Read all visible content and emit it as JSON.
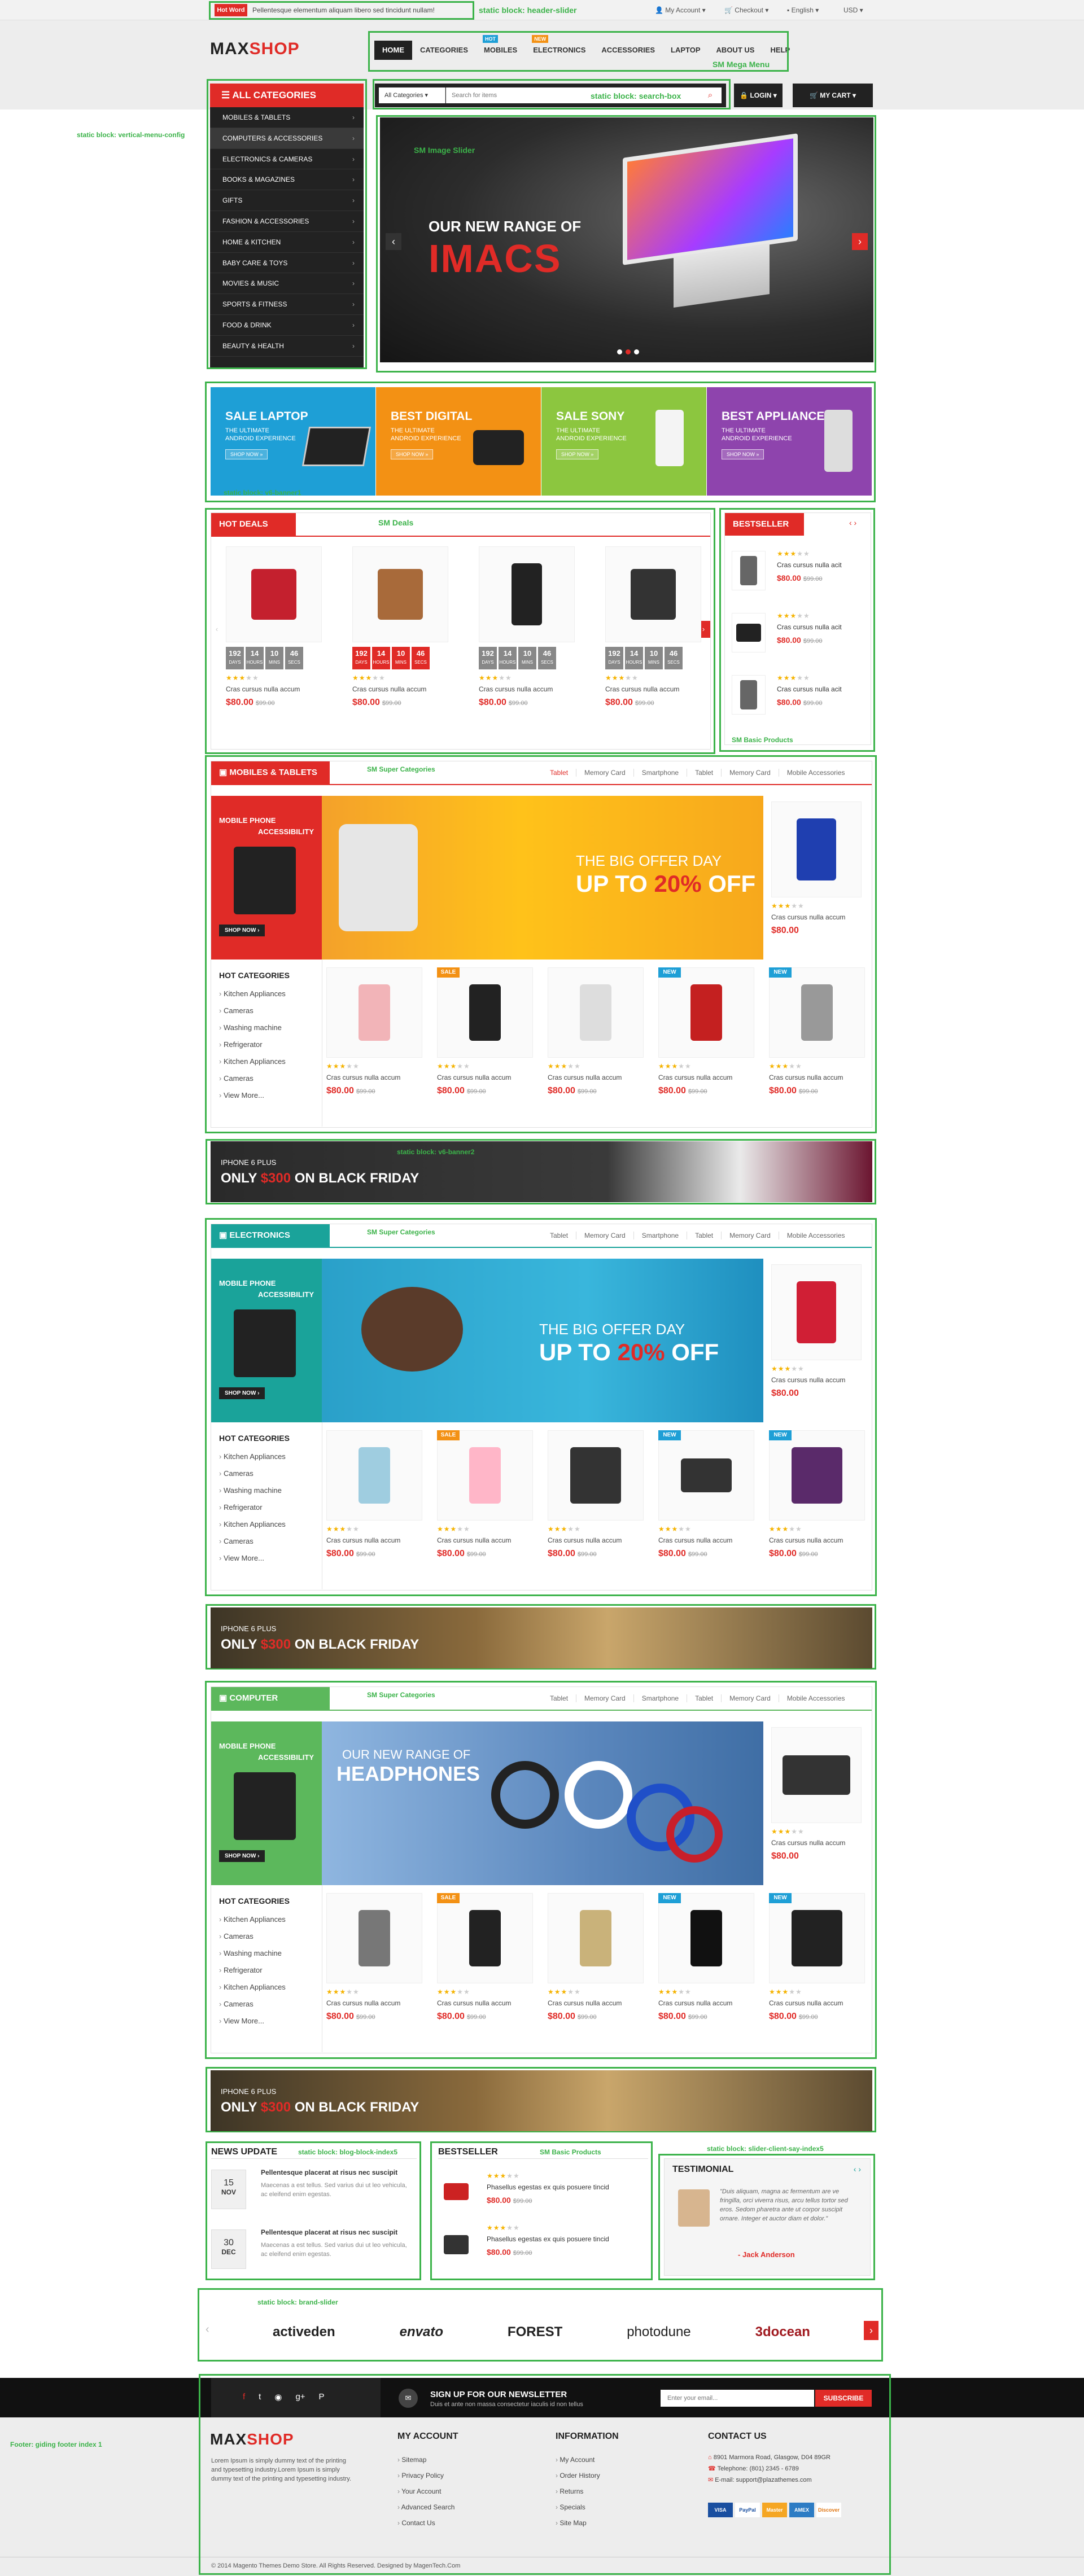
{
  "topbar": {
    "hot_word": "Hot Word",
    "ticker": "Pellentesque elementum aliquam libero sed tincidunt nullam!",
    "account": "My Account",
    "checkout": "Checkout",
    "language": "English",
    "currency": "USD"
  },
  "header": {
    "logo_main": "MAX",
    "logo_accent": "SHOP",
    "search_category": "All Categories",
    "search_placeholder": "Search for items",
    "login": "LOGIN",
    "cart": "MY CART"
  },
  "nav": {
    "items": [
      {
        "label": "HOME",
        "badge": ""
      },
      {
        "label": "CATEGORIES",
        "badge": ""
      },
      {
        "label": "MOBILES",
        "badge": "HOT"
      },
      {
        "label": "ELECTRONICS",
        "badge": "NEW"
      },
      {
        "label": "ACCESSORIES",
        "badge": ""
      },
      {
        "label": "LAPTOP",
        "badge": ""
      },
      {
        "label": "ABOUT US",
        "badge": ""
      },
      {
        "label": "HELP",
        "badge": ""
      }
    ]
  },
  "categories": {
    "title": "ALL CATEGORIES",
    "items": [
      "MOBILES & TABLETS",
      "COMPUTERS & ACCESSORIES",
      "ELECTRONICS & CAMERAS",
      "BOOKS & MAGAZINES",
      "GIFTS",
      "FASHION & ACCESSORIES",
      "HOME & KITCHEN",
      "BABY CARE & TOYS",
      "MOVIES & MUSIC",
      "SPORTS & FITNESS",
      "FOOD & DRINK",
      "BEAUTY & HEALTH"
    ]
  },
  "slider": {
    "line1": "OUR NEW RANGE OF",
    "line2": "IMACS"
  },
  "banners": [
    {
      "title": "SALE LAPTOP",
      "text1": "THE ULTIMATE",
      "text2": "ANDROID EXPERIENCE",
      "cta": "SHOP NOW »",
      "color": "#1e9fd6"
    },
    {
      "title": "BEST DIGITAL",
      "text1": "THE ULTIMATE",
      "text2": "ANDROID EXPERIENCE",
      "cta": "SHOP NOW »",
      "color": "#f39114"
    },
    {
      "title": "SALE SONY",
      "text1": "THE ULTIMATE",
      "text2": "ANDROID EXPERIENCE",
      "cta": "SHOP NOW »",
      "color": "#8cc63f"
    },
    {
      "title": "BEST APPLIANCES",
      "text1": "THE ULTIMATE",
      "text2": "ANDROID EXPERIENCE",
      "cta": "SHOP NOW »",
      "color": "#8e44ad"
    }
  ],
  "annotations": {
    "header_slider": "static block: header-slider",
    "mega_menu": "SM Mega Menu",
    "search_box": "static block: search-box",
    "vertical_menu": "static block: vertical-menu-config",
    "image_slider": "SM Image Slider",
    "v6_banner1": "static block: v6-banner1",
    "sm_deals": "SM Deals",
    "basic_products": "SM Basic Products",
    "super_categories": "SM Super Categories",
    "v6_banner2": "static block: v6-banner2",
    "blog_block": "static block: blog-block-index5",
    "slider_client": "static block: slider-client-say-index5",
    "brand_slider": "static block: brand-slider",
    "footer": "Footer: giding footer index 1"
  },
  "product": {
    "name": "Cras cursus nulla accum",
    "price": "$80.00",
    "old_price": "$99.00"
  },
  "hot_deals": {
    "title": "HOT DEALS",
    "countdown": [
      {
        "v": "192",
        "u": "DAYS"
      },
      {
        "v": "14",
        "u": "HOURS"
      },
      {
        "v": "10",
        "u": "MINS"
      },
      {
        "v": "46",
        "u": "SECS"
      }
    ]
  },
  "bestseller": {
    "title": "BESTSELLER",
    "item_name": "Cras cursus nulla acit"
  },
  "sections": [
    {
      "title": "MOBILES & TABLETS",
      "color": "#e02b27",
      "promo_small": "MOBILE PHONE",
      "promo_small2": "ACCESSIBILITY",
      "banner_l1": "THE BIG OFFER DAY",
      "banner_l2": "UP TO ",
      "banner_pct": "20%",
      "banner_l3": " OFF"
    },
    {
      "title": "ELECTRONICS",
      "color": "#1aa39a",
      "promo_small": "MOBILE PHONE",
      "promo_small2": "ACCESSIBILITY",
      "banner_l1": "THE BIG OFFER DAY",
      "banner_l2": "UP TO ",
      "banner_pct": "20%",
      "banner_l3": " OFF"
    },
    {
      "title": "COMPUTER",
      "color": "#5cb85c",
      "promo_small": "MOBILE PHONE",
      "promo_small2": "ACCESSIBILITY",
      "banner_l1": "OUR NEW RANGE OF",
      "banner_l2": "HEADPHONES",
      "banner_pct": "",
      "banner_l3": ""
    }
  ],
  "sub_tabs": [
    "Tablet",
    "Memory Card",
    "Smartphone",
    "Tablet",
    "Memory Card",
    "Mobile Accessories"
  ],
  "hot_categories": {
    "title": "HOT CATEGORIES",
    "items": [
      "Kitchen Appliances",
      "Cameras",
      "Washing machine",
      "Refrigerator",
      "Kitchen Appliances",
      "Cameras",
      "View More..."
    ]
  },
  "shop_now": "SHOP NOW ›",
  "promo": {
    "line1": "IPHONE 6 PLUS",
    "line2a": "ONLY ",
    "line2b": "$300",
    "line2c": " ON BLACK FRIDAY"
  },
  "news": {
    "title": "NEWS UPDATE",
    "posts": [
      {
        "day": "15",
        "month": "NOV",
        "title": "Pellentesque placerat at risus nec suscipit",
        "text": "Maecenas a est tellus. Sed varius dui ut leo vehicula, ac eleifend enim egestas."
      },
      {
        "day": "30",
        "month": "DEC",
        "title": "Pellentesque placerat at risus nec suscipit",
        "text": "Maecenas a est tellus. Sed varius dui ut leo vehicula, ac eleifend enim egestas."
      }
    ]
  },
  "bestseller2": {
    "title": "BESTSELLER",
    "items": [
      {
        "name": "Phasellus egestas ex quis posuere tincid",
        "price": "$80.00",
        "old": "$99.00"
      },
      {
        "name": "Phasellus egestas ex quis posuere tincid",
        "price": "$80.00",
        "old": "$99.00"
      }
    ]
  },
  "testimonial": {
    "title": "TESTIMONIAL",
    "quote": "\"Duis aliquam, magna ac fermentum are ve fringilla, orci viverra risus, arcu tellus tortor sed eros. Sedom pharetra ante ut corpor suscipit ornare. Integer et auctor diam et dolor.\"",
    "author": "- Jack Anderson"
  },
  "brands": [
    "activeden",
    "envato",
    "FOREST",
    "photodune",
    "3docean"
  ],
  "newsletter": {
    "title": "SIGN UP FOR OUR NEWSLETTER",
    "sub": "Duis et ante non massa consectetur iaculis id non tellus",
    "placeholder": "Enter your email...",
    "button": "SUBSCRIBE"
  },
  "footer": {
    "about": "Lorem Ipsum is simply dummy text of the printing and typesetting industry.Lorem Ipsum is simply dummy text of the printing and typesetting industry.",
    "cols": [
      {
        "title": "MY ACCOUNT",
        "items": [
          "Sitemap",
          "Privacy Policy",
          "Your Account",
          "Advanced Search",
          "Contact Us"
        ]
      },
      {
        "title": "INFORMATION",
        "items": [
          "My Account",
          "Order History",
          "Returns",
          "Specials",
          "Site Map"
        ]
      }
    ],
    "contact": {
      "title": "CONTACT US",
      "address": "8901 Marmora Road, Glasgow, D04 89GR",
      "phone": "Telephone: (801) 2345 - 6789",
      "email": "E-mail: support@plazathemes.com"
    },
    "payments": [
      "VISA",
      "PayPal",
      "Master",
      "AMEX",
      "Discover"
    ],
    "copyright": "© 2014 Magento Themes Demo Store. All Rights Reserved. Designed by MagenTech.Com"
  }
}
